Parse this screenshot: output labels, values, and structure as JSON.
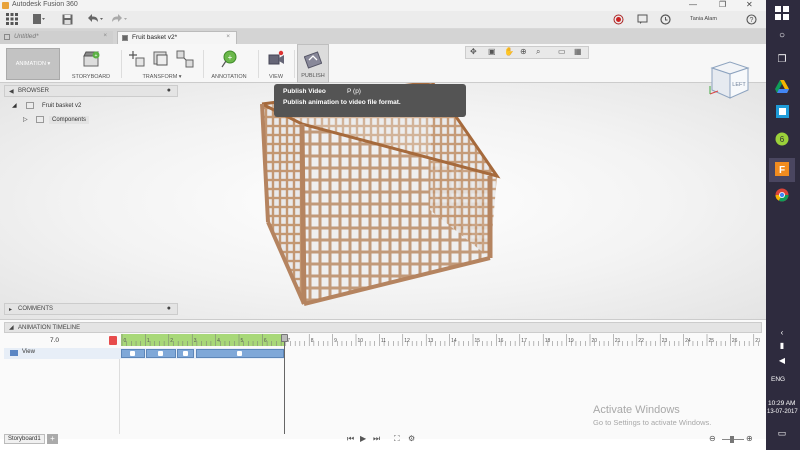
{
  "window": {
    "title": "Autodesk Fusion 360",
    "user": "Tania Alam",
    "controls": {
      "minimize": "—",
      "restore": "❐",
      "close": "✕"
    }
  },
  "tabs": [
    {
      "label": "Untitled*",
      "active": false
    },
    {
      "label": "Fruit basket v2*",
      "active": true
    }
  ],
  "toolbar": {
    "workspace": "ANIMATION",
    "groups": [
      {
        "label": "STORYBOARD"
      },
      {
        "label": "TRANSFORM ▾"
      },
      {
        "label": "ANNOTATION"
      },
      {
        "label": "VIEW"
      },
      {
        "label": "PUBLISH"
      }
    ]
  },
  "browser": {
    "title": "BROWSER",
    "root": "Fruit basket v2",
    "child": "Components"
  },
  "tooltip": {
    "title": "Publish Video",
    "shortcut": "P (p)",
    "description": "Publish animation to video file format."
  },
  "viewcube": {
    "face": "LEFT"
  },
  "comments": {
    "title": "COMMENTS"
  },
  "timeline": {
    "title": "ANIMATION TIMELINE",
    "current_time": "7.0",
    "track": "View",
    "ruler_ticks": [
      "0",
      "1",
      "2",
      "3",
      "4",
      "5",
      "6",
      "7",
      "8",
      "9",
      "10",
      "11",
      "12",
      "13",
      "14",
      "15",
      "16",
      "17",
      "18",
      "19",
      "20",
      "21",
      "22",
      "23",
      "24",
      "25",
      "26",
      "27"
    ],
    "storyboard_tab": "Storyboard1",
    "add_tab": "+"
  },
  "watermark": {
    "line1": "Activate Windows",
    "line2": "Go to Settings to activate Windows."
  },
  "taskbar": {
    "lang": "ENG",
    "time": "10:29 AM",
    "date": "13-07-2017"
  },
  "colors": {
    "accent_green": "#a8d878",
    "clip_blue": "#7fa8d8",
    "sidebar_bg": "#2e2b3e"
  }
}
